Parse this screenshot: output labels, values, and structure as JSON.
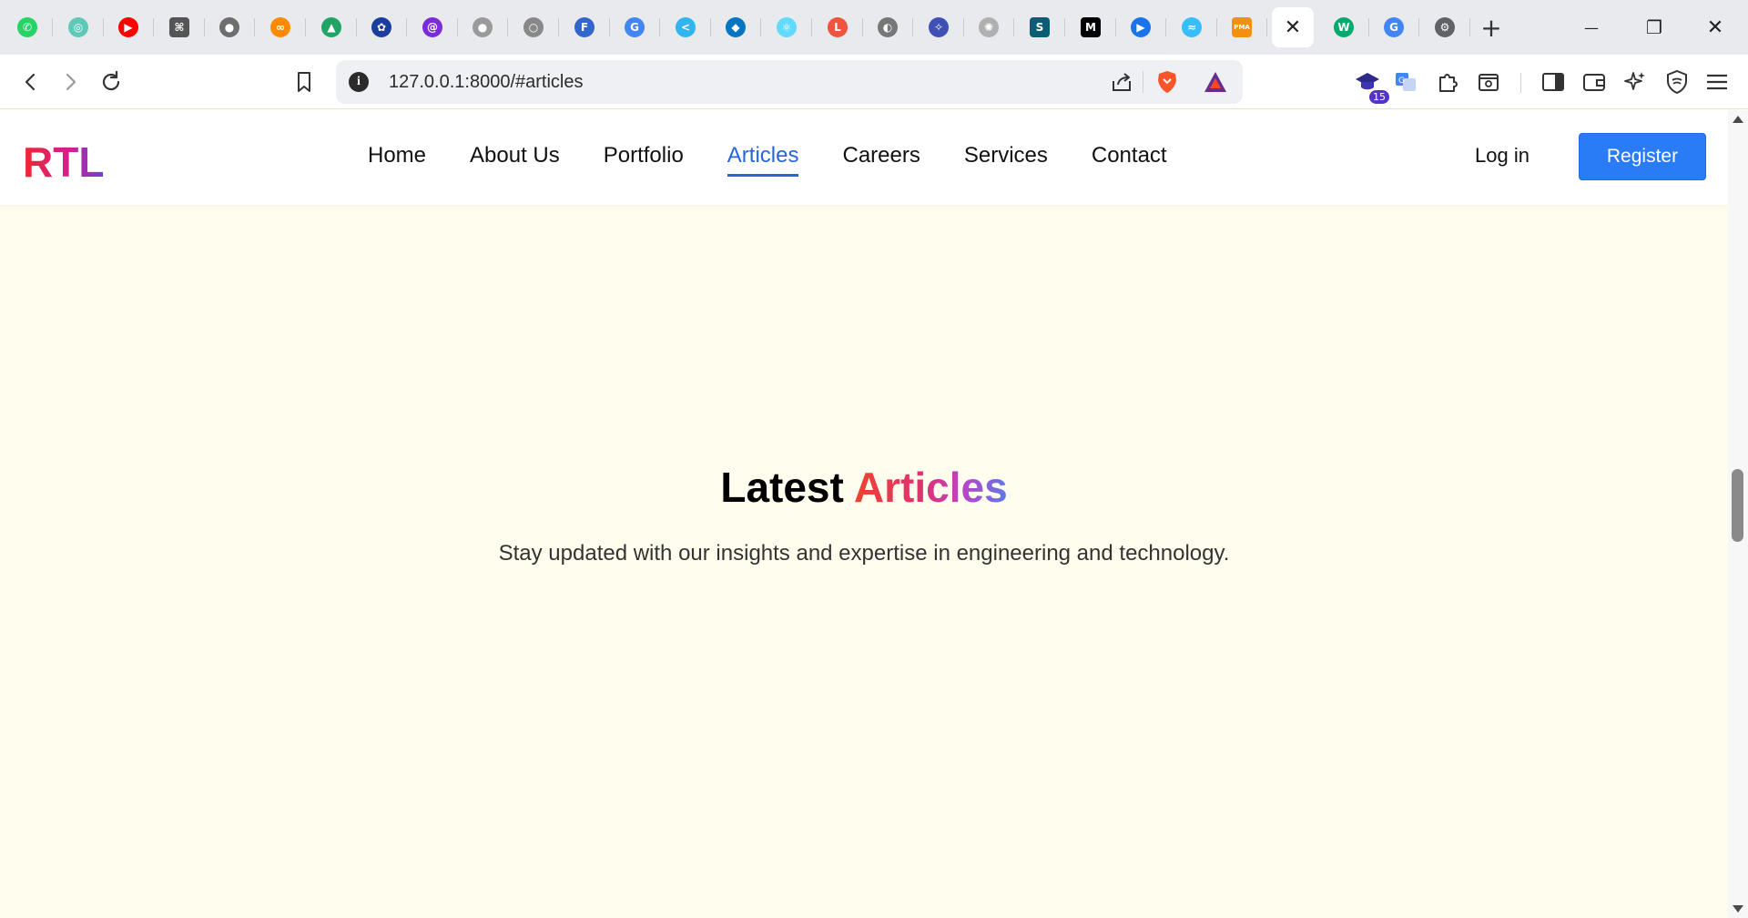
{
  "browser": {
    "tabs": [
      {
        "name": "whatsapp",
        "color": "#25d366",
        "glyph": "✆"
      },
      {
        "name": "fiverr-like",
        "color": "#5fc9b9",
        "glyph": "◎"
      },
      {
        "name": "youtube",
        "color": "#ff0000",
        "glyph": "▶"
      },
      {
        "name": "grid-app",
        "color": "#555555",
        "glyph": "⌘"
      },
      {
        "name": "github",
        "color": "#6e6e6e",
        "glyph": "●"
      },
      {
        "name": "coursera",
        "color": "#ff8a00",
        "glyph": "∞"
      },
      {
        "name": "google-drive",
        "color": "#1fa463",
        "glyph": "▲"
      },
      {
        "name": "butterfly",
        "color": "#1a3d9e",
        "glyph": "✿"
      },
      {
        "name": "swirl",
        "color": "#7b2bd8",
        "glyph": "@"
      },
      {
        "name": "github-2",
        "color": "#9a9a9a",
        "glyph": "●"
      },
      {
        "name": "circle-ring",
        "color": "#888888",
        "glyph": "○"
      },
      {
        "name": "f-circle",
        "color": "#3366cc",
        "glyph": "F"
      },
      {
        "name": "google",
        "color": "#4285f4",
        "glyph": "G"
      },
      {
        "name": "flutter",
        "color": "#31b4f0",
        "glyph": "<"
      },
      {
        "name": "dart",
        "color": "#0175c2",
        "glyph": "◆"
      },
      {
        "name": "react",
        "color": "#61dafb",
        "glyph": "⚛"
      },
      {
        "name": "laravel",
        "color": "#f05340",
        "glyph": "L"
      },
      {
        "name": "globe",
        "color": "#777777",
        "glyph": "◐"
      },
      {
        "name": "bird",
        "color": "#3f51b5",
        "glyph": "✧"
      },
      {
        "name": "openai",
        "color": "#b0b0b0",
        "glyph": "✺"
      },
      {
        "name": "s-tile",
        "color": "#0a5d73",
        "glyph": "S"
      },
      {
        "name": "medium",
        "color": "#000000",
        "glyph": "M"
      },
      {
        "name": "play",
        "color": "#1a73e8",
        "glyph": "▶"
      },
      {
        "name": "tailwind",
        "color": "#38bdf8",
        "glyph": "≈"
      },
      {
        "name": "phpmyadmin",
        "color": "#f29111",
        "glyph": "PMA"
      }
    ],
    "active_tab_close": "✕",
    "after_tabs": [
      {
        "name": "w3schools",
        "color": "#04aa6d",
        "glyph": "W"
      },
      {
        "name": "google-2",
        "color": "#4285f4",
        "glyph": "G"
      },
      {
        "name": "settings",
        "color": "#5f6368",
        "glyph": "⚙"
      }
    ],
    "new_tab": "+",
    "window": {
      "minimize": "—",
      "restore": "❐",
      "close": "✕"
    },
    "url": "127.0.0.1:8000/#articles",
    "extension_badge": "15"
  },
  "site": {
    "logo": "RTL",
    "nav": [
      {
        "label": "Home",
        "active": false
      },
      {
        "label": "About Us",
        "active": false
      },
      {
        "label": "Portfolio",
        "active": false
      },
      {
        "label": "Articles",
        "active": true
      },
      {
        "label": "Careers",
        "active": false
      },
      {
        "label": "Services",
        "active": false
      },
      {
        "label": "Contact",
        "active": false
      }
    ],
    "login_label": "Log in",
    "register_label": "Register",
    "accent_color": "#2a7cf6"
  },
  "articles": {
    "heading_plain": "Latest",
    "heading_accent": "Articles",
    "subtitle": "Stay updated with our insights and expertise in engineering and technology."
  }
}
